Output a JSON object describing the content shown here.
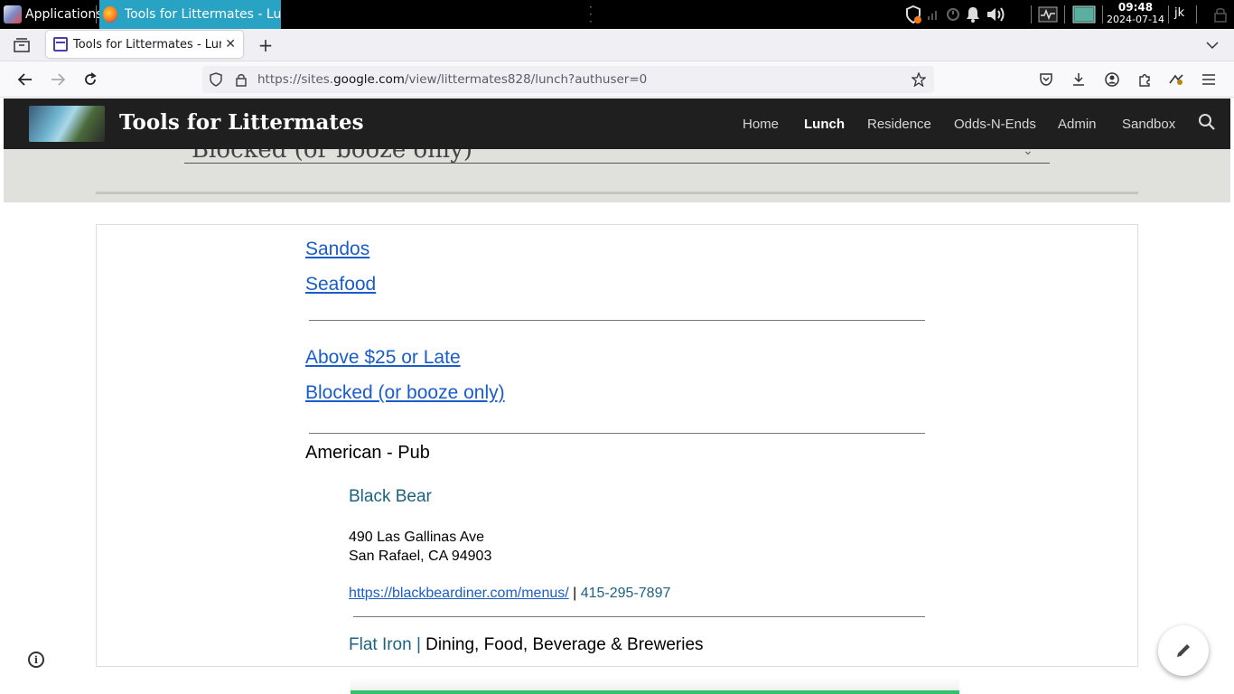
{
  "os": {
    "app_menu_label": "Applications",
    "task_label": "Tools for Littermates - Lun...",
    "clock_time": "09:48",
    "clock_date": "2024-07-14",
    "user": "jk"
  },
  "browser": {
    "tab_title": "Tools for Littermates - Lunch",
    "url_prefix": "https://sites.",
    "url_domain": "google.com",
    "url_path": "/view/littermates828/lunch?authuser=0"
  },
  "site": {
    "title": "Tools for Littermates",
    "nav": [
      "Home",
      "Lunch",
      "Residence",
      "Odds-N-Ends",
      "Admin",
      "Sandbox"
    ],
    "active_nav": "Lunch"
  },
  "grey_band": {
    "select_value": "Blocked (or booze only)"
  },
  "content": {
    "category_links": [
      "Sandos",
      "Seafood"
    ],
    "other_links": [
      "Above $25 or Late",
      "Blocked (or booze only)"
    ],
    "section_title": "American - Pub",
    "restaurant": {
      "name": "Black Bear",
      "address_line1": "490 Las Gallinas Ave",
      "address_line2": "San Rafael, CA 94903",
      "menu_url": "https://blackbeardiner.com/menus/",
      "separator": " | ",
      "phone": "415-295-7897"
    },
    "next_restaurant": {
      "name": "Flat Iron |",
      "description": " Dining, Food, Beverage & Breweries"
    }
  },
  "colors": {
    "header_bg": "#1f1f1f",
    "link": "#1a5cc8",
    "restaurant_name": "#1d6280",
    "grey_band": "#e0e0dc",
    "progress": "#33c26a"
  }
}
